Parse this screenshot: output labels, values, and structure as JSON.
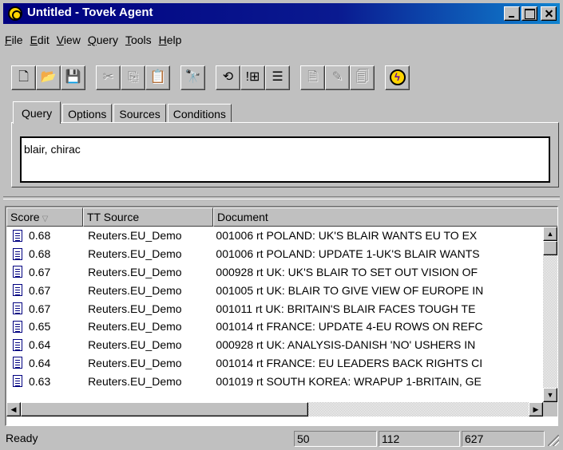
{
  "window": {
    "title": "Untitled - Tovek Agent"
  },
  "menu": [
    {
      "u": "F",
      "rest": "ile"
    },
    {
      "u": "E",
      "rest": "dit"
    },
    {
      "u": "V",
      "rest": "iew"
    },
    {
      "u": "Q",
      "rest": "uery"
    },
    {
      "u": "T",
      "rest": "ools"
    },
    {
      "u": "H",
      "rest": "elp"
    }
  ],
  "toolbar": {
    "icons": [
      "new-document-icon",
      "open-folder-icon",
      "save-icon",
      "cut-icon",
      "copy-icon",
      "paste-icon",
      "find-icon",
      "refresh-query-icon",
      "search-results-icon",
      "list-results-icon",
      "document-properties-icon",
      "edit-document-icon",
      "document-info-icon",
      "lightning-icon"
    ]
  },
  "tabs": [
    {
      "label": "Query",
      "active": true
    },
    {
      "label": "Options",
      "active": false
    },
    {
      "label": "Sources",
      "active": false
    },
    {
      "label": "Conditions",
      "active": false
    }
  ],
  "query": {
    "text": "blair, chirac"
  },
  "list": {
    "columns": {
      "score": "Score",
      "source": "TT Source",
      "document": "Document"
    },
    "rows": [
      {
        "score": "0.68",
        "source": "Reuters.EU_Demo",
        "document": "001006 rt POLAND: UK'S BLAIR WANTS EU TO EX"
      },
      {
        "score": "0.68",
        "source": "Reuters.EU_Demo",
        "document": "001006 rt POLAND: UPDATE 1-UK'S BLAIR WANTS"
      },
      {
        "score": "0.67",
        "source": "Reuters.EU_Demo",
        "document": "000928 rt UK: UK'S BLAIR TO SET OUT VISION OF"
      },
      {
        "score": "0.67",
        "source": "Reuters.EU_Demo",
        "document": "001005 rt UK: BLAIR TO GIVE VIEW OF EUROPE IN"
      },
      {
        "score": "0.67",
        "source": "Reuters.EU_Demo",
        "document": "001011 rt UK: BRITAIN'S BLAIR FACES TOUGH TE"
      },
      {
        "score": "0.65",
        "source": "Reuters.EU_Demo",
        "document": "001014 rt FRANCE: UPDATE 4-EU ROWS ON REFC"
      },
      {
        "score": "0.64",
        "source": "Reuters.EU_Demo",
        "document": "000928 rt UK: ANALYSIS-DANISH 'NO' USHERS IN"
      },
      {
        "score": "0.64",
        "source": "Reuters.EU_Demo",
        "document": "001014 rt FRANCE: EU LEADERS BACK RIGHTS CI"
      },
      {
        "score": "0.63",
        "source": "Reuters.EU_Demo",
        "document": "001019 rt SOUTH KOREA: WRAPUP 1-BRITAIN, GE"
      }
    ]
  },
  "status": {
    "text": "Ready",
    "p1": "50",
    "p2": "112",
    "p3": "627"
  }
}
